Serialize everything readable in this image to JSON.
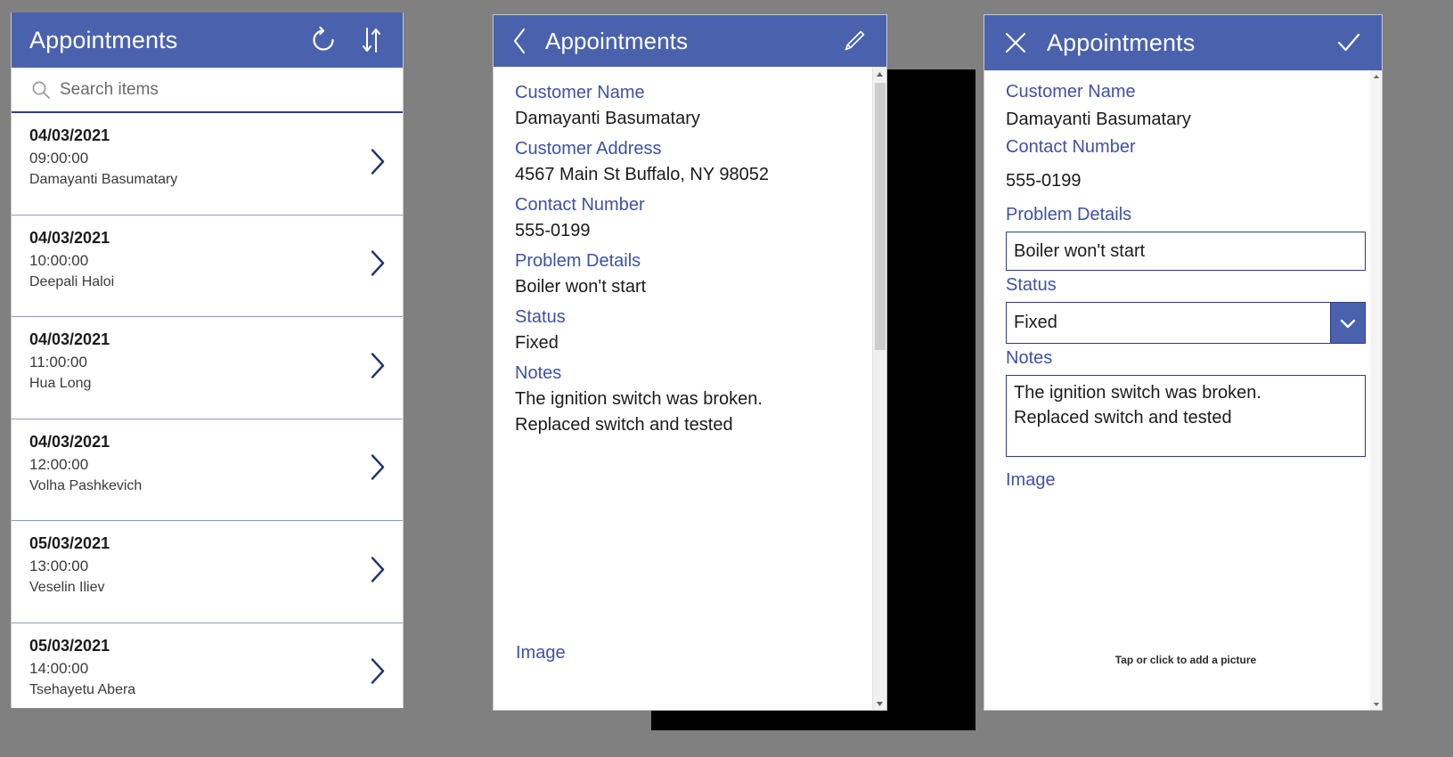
{
  "theme": {
    "header_blue": "#4a62ae",
    "label_blue": "#3f51a5",
    "border_blue": "#2b3f7e",
    "page_background": "#808080",
    "panel_background": "#ffffff"
  },
  "list_panel": {
    "title": "Appointments",
    "refresh_icon": "refresh-icon",
    "sort_icon": "sort-icon",
    "search": {
      "icon": "search-icon",
      "placeholder": "Search items",
      "value": ""
    },
    "items": [
      {
        "date": "04/03/2021",
        "time": "09:00:00",
        "name": "Damayanti Basumatary",
        "chevron": "chevron-right-icon"
      },
      {
        "date": "04/03/2021",
        "time": "10:00:00",
        "name": "Deepali Haloi",
        "chevron": "chevron-right-icon"
      },
      {
        "date": "04/03/2021",
        "time": "11:00:00",
        "name": "Hua Long",
        "chevron": "chevron-right-icon"
      },
      {
        "date": "04/03/2021",
        "time": "12:00:00",
        "name": "Volha Pashkevich",
        "chevron": "chevron-right-icon"
      },
      {
        "date": "05/03/2021",
        "time": "13:00:00",
        "name": "Veselin Iliev",
        "chevron": "chevron-right-icon"
      },
      {
        "date": "05/03/2021",
        "time": "14:00:00",
        "name": "Tsehayetu Abera",
        "chevron": "chevron-right-icon"
      }
    ]
  },
  "detail_panel": {
    "title": "Appointments",
    "back_icon": "chevron-left-icon",
    "edit_icon": "pencil-icon",
    "fields": [
      {
        "label": "Customer Name",
        "value": "Damayanti Basumatary"
      },
      {
        "label": "Customer Address",
        "value": "4567 Main St Buffalo, NY 98052"
      },
      {
        "label": "Contact Number",
        "value": "555-0199"
      },
      {
        "label": "Problem Details",
        "value": "Boiler won't start"
      },
      {
        "label": "Status",
        "value": "Fixed"
      },
      {
        "label": "Notes",
        "value": "The ignition switch was broken.\nReplaced switch and tested"
      }
    ],
    "image_label": "Image",
    "scrollbar": {
      "up_icon": "scroll-up-icon",
      "down_icon": "scroll-down-icon"
    }
  },
  "edit_panel": {
    "title": "Appointments",
    "close_icon": "close-icon",
    "confirm_icon": "checkmark-icon",
    "customer_name_label": "Customer Name",
    "customer_name_value": "Damayanti Basumatary",
    "contact_number_label": "Contact Number",
    "contact_number_value": "555-0199",
    "problem_details_label": "Problem Details",
    "problem_details_value": "Boiler won't start",
    "status_label": "Status",
    "status_value": "Fixed",
    "status_dropdown_icon": "chevron-down-icon",
    "notes_label": "Notes",
    "notes_value": "The ignition switch was broken.\nReplaced switch and tested",
    "image_label": "Image",
    "image_hint": "Tap or click to add a picture",
    "scrollbar": {
      "up_icon": "scroll-up-icon",
      "down_icon": "scroll-down-icon"
    }
  }
}
